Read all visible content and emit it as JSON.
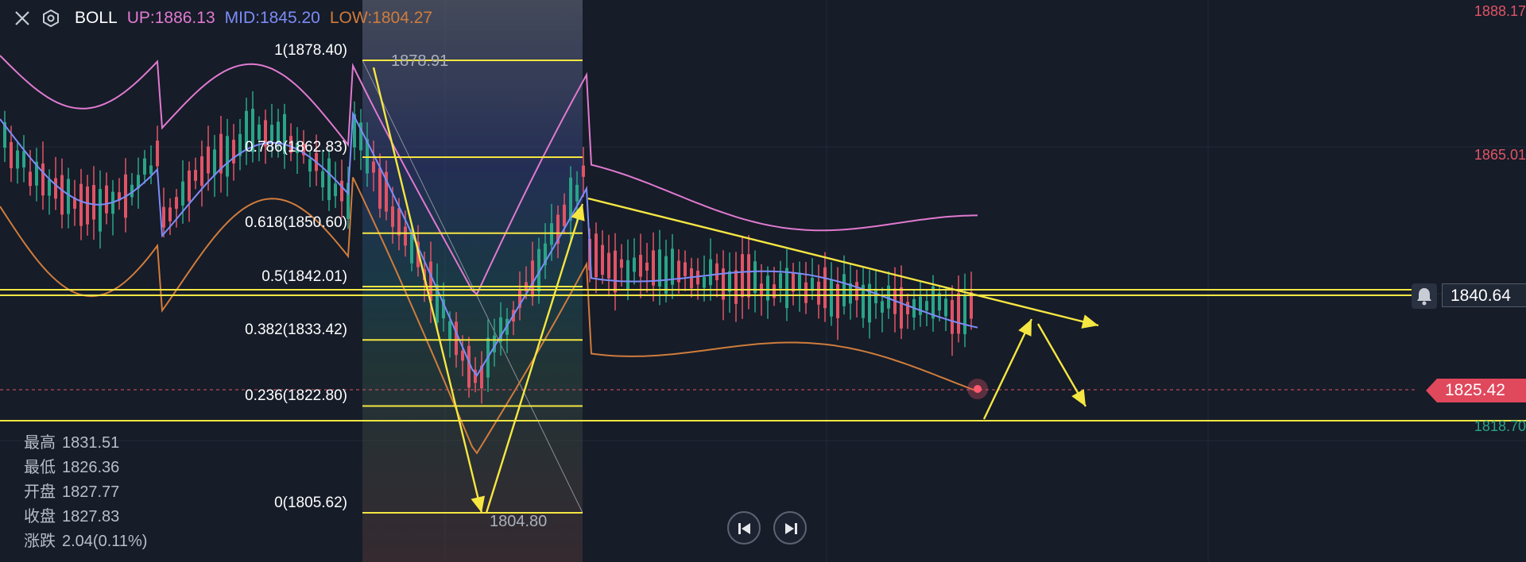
{
  "indicator": {
    "name": "BOLL",
    "up": "UP:1886.13",
    "mid": "MID:1845.20",
    "low": "LOW:1804.27",
    "up_color": "#e07ad0",
    "mid_color": "#7c8cf8",
    "low_color": "#cf7c3c"
  },
  "price_axis": {
    "top": "1888.17",
    "mid": "1865.01",
    "bottom": "1818.70",
    "label_color": "#e05466",
    "bottom_color": "#2aa488"
  },
  "current_price": "1825.42",
  "alert_price": "1840.64",
  "fib_levels": [
    {
      "label": "1(1878.40)",
      "price": 1878.4
    },
    {
      "label": "0.786(1862.83)",
      "price": 1862.83
    },
    {
      "label": "0.618(1850.60)",
      "price": 1850.6
    },
    {
      "label": "0.5(1842.01)",
      "price": 1842.01
    },
    {
      "label": "0.382(1833.42)",
      "price": 1833.42
    },
    {
      "label": "0.236(1822.80)",
      "price": 1822.8
    },
    {
      "label": "0(1805.62)",
      "price": 1805.62
    }
  ],
  "extremes": {
    "high": "1878.91",
    "low": "1804.80"
  },
  "stats": [
    {
      "label": "最高",
      "value": "1831.51"
    },
    {
      "label": "最低",
      "value": "1826.36"
    },
    {
      "label": "开盘",
      "value": "1827.77"
    },
    {
      "label": "收盘",
      "value": "1827.83"
    },
    {
      "label": "涨跌",
      "value": "2.04(0.11%)"
    }
  ],
  "icons": {
    "close": "close-icon",
    "settings": "hexagon-settings-icon",
    "alert": "bell-icon",
    "prev": "skip-back-icon",
    "next": "skip-forward-icon"
  },
  "colors": {
    "up": "#2aa488",
    "down": "#e05466",
    "fib": "#f5e642",
    "background": "#161c28"
  }
}
